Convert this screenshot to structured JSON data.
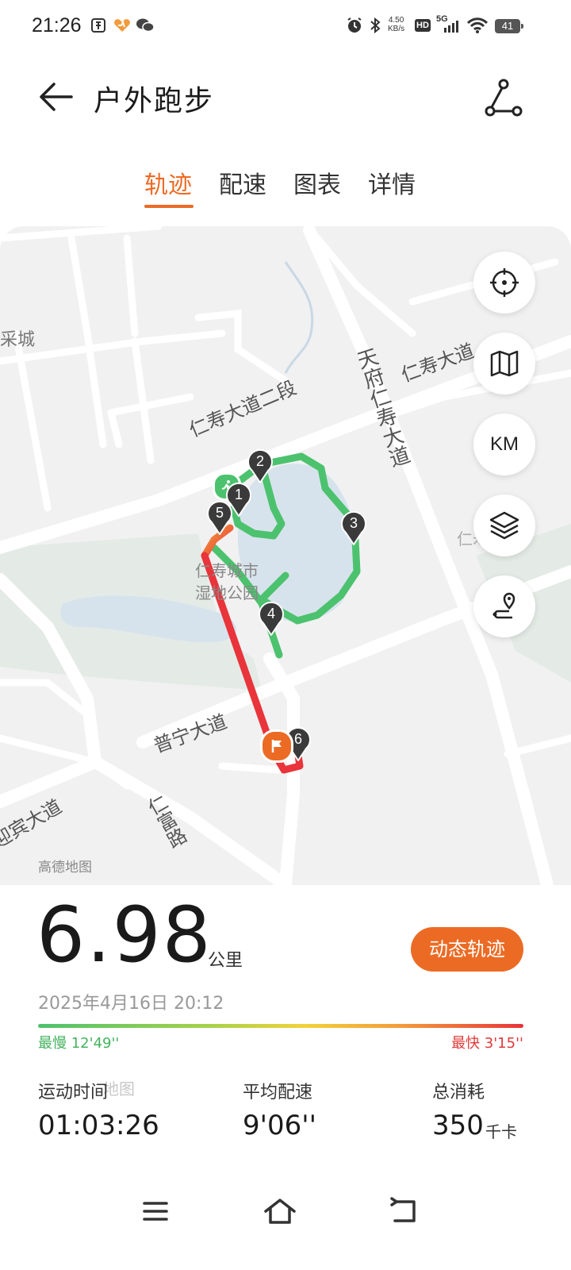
{
  "status": {
    "time": "21:26",
    "net_speed_value": "4.50",
    "net_speed_unit": "KB/s",
    "hd": "HD",
    "signal": "5G",
    "battery": "41"
  },
  "header": {
    "title": "户外跑步"
  },
  "tabs": [
    {
      "label": "轨迹",
      "active": true
    },
    {
      "label": "配速",
      "active": false
    },
    {
      "label": "图表",
      "active": false
    },
    {
      "label": "详情",
      "active": false
    }
  ],
  "map": {
    "labels": {
      "left_city": "采城",
      "renshou_road_2": "仁寿大道二段",
      "renshou_road": "仁寿大道",
      "tianfu_road": "天府仁寿大道",
      "park_line1": "仁寿城市",
      "park_line2": "湿地公园",
      "puning_road": "普宁大道",
      "yingbin_road": "迎宾大道",
      "renfu_road": "仁富路",
      "right_partial": "仁寿中心"
    },
    "km_markers": [
      "1",
      "2",
      "3",
      "4",
      "5",
      "6"
    ],
    "controls": {
      "locate": "locate-icon",
      "map_type": "map-icon",
      "km_label": "KM",
      "layers": "layers-icon",
      "route": "route-pin-icon"
    },
    "colors": {
      "slow": "#4cc26e",
      "fast": "#e8343a",
      "accent": "#ec6b24"
    }
  },
  "summary": {
    "map_source": "高德地图",
    "distance": "6.98",
    "distance_unit": "公里",
    "dynamic_button": "动态轨迹",
    "datetime": "2025年4月16日 20:12",
    "slowest_label": "最慢 12'49''",
    "fastest_label": "最快 3'15''",
    "watermark": "地图"
  },
  "stats": [
    {
      "label": "运动时间",
      "value": "01:03:26",
      "unit": ""
    },
    {
      "label": "平均配速",
      "value": "9'06''",
      "unit": ""
    },
    {
      "label": "总消耗",
      "value": "350",
      "unit": "千卡"
    }
  ]
}
